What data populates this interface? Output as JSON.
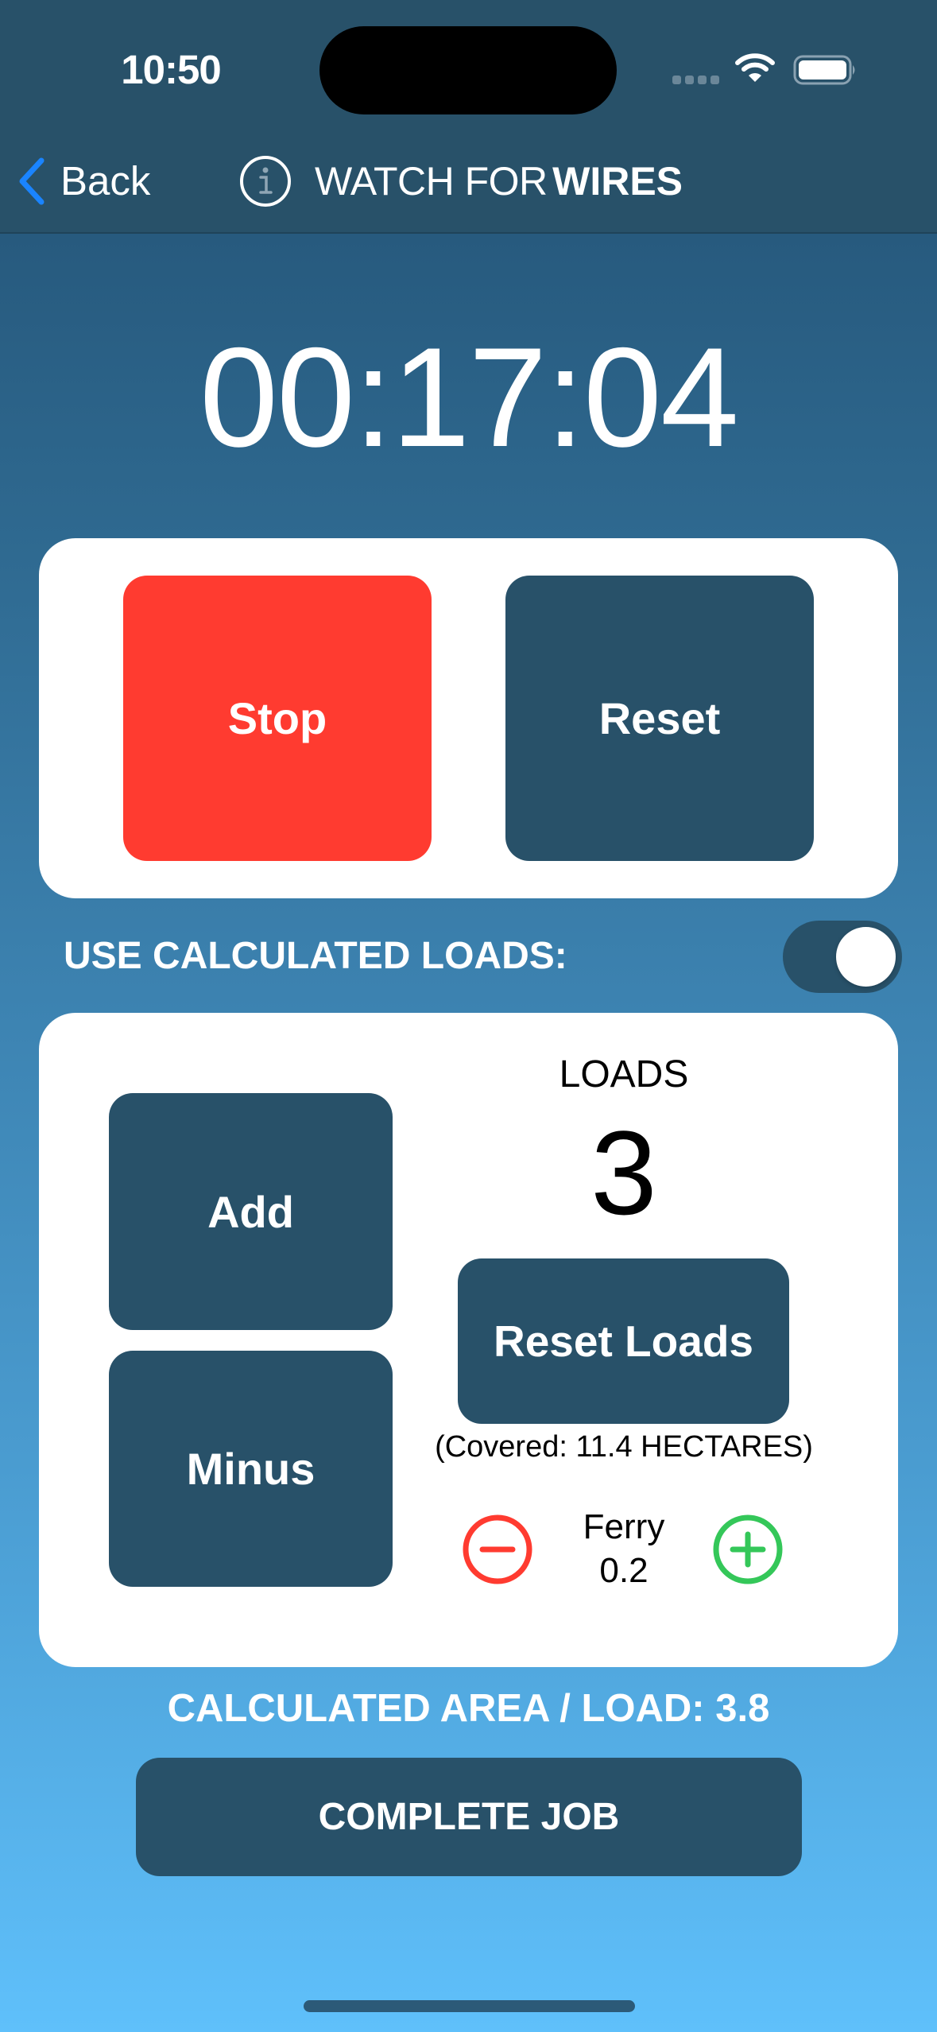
{
  "status_bar": {
    "time": "10:50",
    "icons": [
      "signal-dots-icon",
      "wifi-icon",
      "battery-icon"
    ]
  },
  "nav": {
    "back_label": "Back",
    "back_icon": "chevron-left-icon",
    "info_icon": "info-circle-icon",
    "title_prefix": "WATCH FOR",
    "title_emphasis": "WIRES"
  },
  "timer": {
    "value": "00:17:04"
  },
  "timer_controls": {
    "stop_label": "Stop",
    "reset_label": "Reset"
  },
  "calculated_loads": {
    "label": "USE CALCULATED LOADS:",
    "enabled": true
  },
  "loads": {
    "add_label": "Add",
    "minus_label": "Minus",
    "title": "LOADS",
    "count": "3",
    "reset_loads_label": "Reset Loads",
    "covered_text": "(Covered: 11.4 HECTARES)",
    "ferry": {
      "label": "Ferry",
      "value": "0.2",
      "decrement_icon": "minus-circle-icon",
      "increment_icon": "plus-circle-icon"
    }
  },
  "summary": {
    "calculated_area_text": "CALCULATED AREA / LOAD: 3.8"
  },
  "actions": {
    "complete_job_label": "COMPLETE JOB"
  },
  "colors": {
    "header": "#285169",
    "stop": "#ff3b30",
    "primary_button": "#285169",
    "ferry_minus": "#ff3b30",
    "ferry_plus": "#34c759",
    "back_chevron": "#1a84ff"
  }
}
